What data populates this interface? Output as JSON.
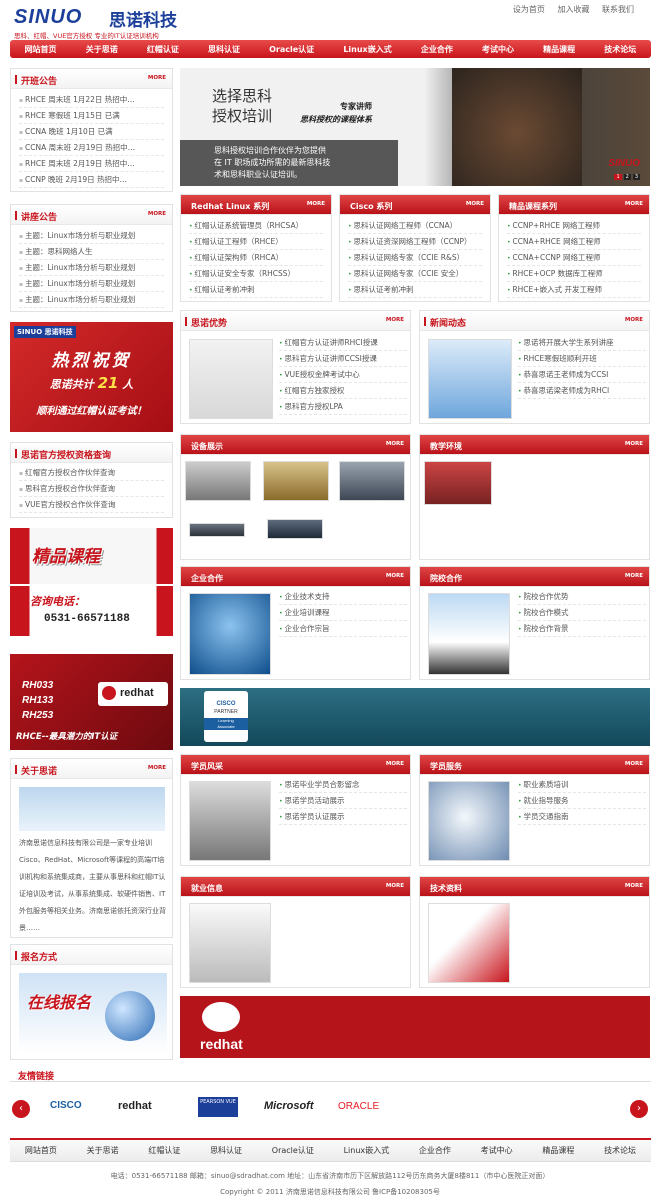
{
  "header": {
    "logo_en": "SINUO",
    "logo_cn": "思诺科技",
    "tagline": "思科、红帽、VUE官方授权  专业的IT认证培训机构",
    "toplinks": [
      "设为首页",
      "加入收藏",
      "联系我们"
    ]
  },
  "nav": [
    "网站首页",
    "关于思诺",
    "红帽认证",
    "思科认证",
    "Oracle认证",
    "Linux嵌入式",
    "企业合作",
    "考试中心",
    "精品课程",
    "技术论坛"
  ],
  "more": "MORE",
  "open_class": {
    "title": "开班公告",
    "items": [
      "RHCE 周末班 1月22日 热招中…",
      "RHCE 寒假班 1月15日 已满",
      "CCNA 晚班 1月10日 已满",
      "CCNA 周末班 2月19日 热招中…",
      "RHCE 周末班 2月19日 热招中…",
      "CCNP 晚班 2月19日 热招中…"
    ]
  },
  "lecture": {
    "title": "讲座公告",
    "items": [
      "主题：Linux市场分析与职业规划",
      "主题：思科网络人生",
      "主题：Linux市场分析与职业规划",
      "主题：Linux市场分析与职业规划",
      "主题：Linux市场分析与职业规划"
    ]
  },
  "congrats": {
    "brand": "SINUO 思诺科技",
    "l1": "热烈祝贺",
    "l2a": "思诺共计",
    "num": "21",
    "l2b": "人",
    "l3": "顺利通过红帽认证考试！"
  },
  "query": {
    "title": "思诺官方授权资格查询",
    "items": [
      "红帽官方授权合作伙伴查询",
      "思科官方授权合作伙伴查询",
      "VUE官方授权合作伙伴查询"
    ]
  },
  "promo": {
    "t1": "精品课程",
    "t2": "咨询电话：",
    "phone": "0531-66571188"
  },
  "rh_banner": {
    "codes": [
      "RH033",
      "RH133",
      "RH253"
    ],
    "logo": "redhat",
    "slogan": "RHCE--最具潜力的IT认证"
  },
  "about": {
    "title": "关于思诺",
    "text": "济南思诺信息科技有限公司是一家专业培训Cisco、RedHat、Microsoft等课程的高端IT培训机构和系统集成商，主要从事思科和红帽IT认证培训及考试，从事系统集成、软硬件销售、IT外包服务等相关业务。济南思诺依托资深行业背景……"
  },
  "signup": {
    "title": "报名方式",
    "banner": "在线报名"
  },
  "hero": {
    "h1": "选择思科",
    "h2": "授权培训",
    "sub1": "专家讲师",
    "sub2": "思科授权的课程体系",
    "p1": "思科授权培训合作伙伴为您提供",
    "p2": "在 IT 职场成功所需的最新思科技",
    "p3": "术和思科职业认证培训。",
    "brand": "SINUO",
    "dots": [
      "1",
      "2",
      "3"
    ]
  },
  "series": [
    {
      "title": "Redhat Linux 系列",
      "items": [
        "红帽认证系统管理员（RHCSA）",
        "红帽认证工程师（RHCE）",
        "红帽认证架构师（RHCA）",
        "红帽认证安全专家（RHCSS）",
        "红帽认证考前冲刺"
      ]
    },
    {
      "title": "Cisco 系列",
      "items": [
        "思科认证网络工程师（CCNA）",
        "思科认证资深网络工程师（CCNP）",
        "思科认证网络专家（CCIE R&S）",
        "思科认证网络专家（CCIE 安全）",
        "思科认证考前冲刺"
      ]
    },
    {
      "title": "精品课程系列",
      "items": [
        "CCNP+RHCE 网络工程师",
        "CCNA+RHCE 网络工程师",
        "CCNA+CCNP 网络工程师",
        "RHCE+OCP 数据库工程师",
        "RHCE+嵌入式 开发工程师"
      ]
    }
  ],
  "advantage": {
    "title": "思诺优势",
    "items": [
      "红帽官方认证讲师RHCI授课",
      "思科官方认证讲师CCSI授课",
      "VUE授权金牌考试中心",
      "红帽官方独家授权",
      "思科官方授权LPA"
    ]
  },
  "news": {
    "title": "新闻动态",
    "items": [
      "思诺将开展大学生系列讲座",
      "RHCE寒假班顺利开班",
      "恭喜思诺王老师成为CCSI",
      "恭喜思诺梁老师成为RHCI"
    ]
  },
  "equipment": {
    "title": "设备展示"
  },
  "environment": {
    "title": "教学环境"
  },
  "enterprise": {
    "title": "企业合作",
    "items": [
      "企业技术支持",
      "企业培训课程",
      "企业合作宗旨"
    ]
  },
  "campus": {
    "title": "院校合作",
    "items": [
      "院校合作优势",
      "院校合作模式",
      "院校合作背景"
    ]
  },
  "cisco_banner": {
    "l1": "CISCO",
    "l2": "PARTNER",
    "l3": "Learning",
    "l4": "Associate"
  },
  "students": {
    "title": "学员风采",
    "items": [
      "思诺毕业学员合影留念",
      "思诺学员活动展示",
      "思诺学员认证展示"
    ]
  },
  "service": {
    "title": "学员服务",
    "items": [
      "职业素质培训",
      "就业指导服务",
      "学员交通指南"
    ]
  },
  "jobs": {
    "title": "就业信息"
  },
  "tech": {
    "title": "技术资料"
  },
  "rh_big": {
    "logo": "redhat"
  },
  "links": {
    "title": "友情链接",
    "logos": [
      "CISCO",
      "redhat",
      "PEARSON VUE",
      "Microsoft",
      "ORACLE"
    ]
  },
  "footer": {
    "nav": [
      "网站首页",
      "关于思诺",
      "红帽认证",
      "思科认证",
      "Oracle认证",
      "Linux嵌入式",
      "企业合作",
      "考试中心",
      "精品课程",
      "技术论坛"
    ],
    "line1": "电话：0531-66571188  邮箱：sinuo@sdradhat.com  地址：山东省济南市历下区解放路112号历东商务大厦8楼811（市中心医院正对面）",
    "line2": "Copyright © 2011 济南思诺信息科技有限公司 鲁ICP备10208305号"
  },
  "colors": {
    "brand_red": "#c8141c",
    "brand_blue": "#1c3f9a"
  }
}
